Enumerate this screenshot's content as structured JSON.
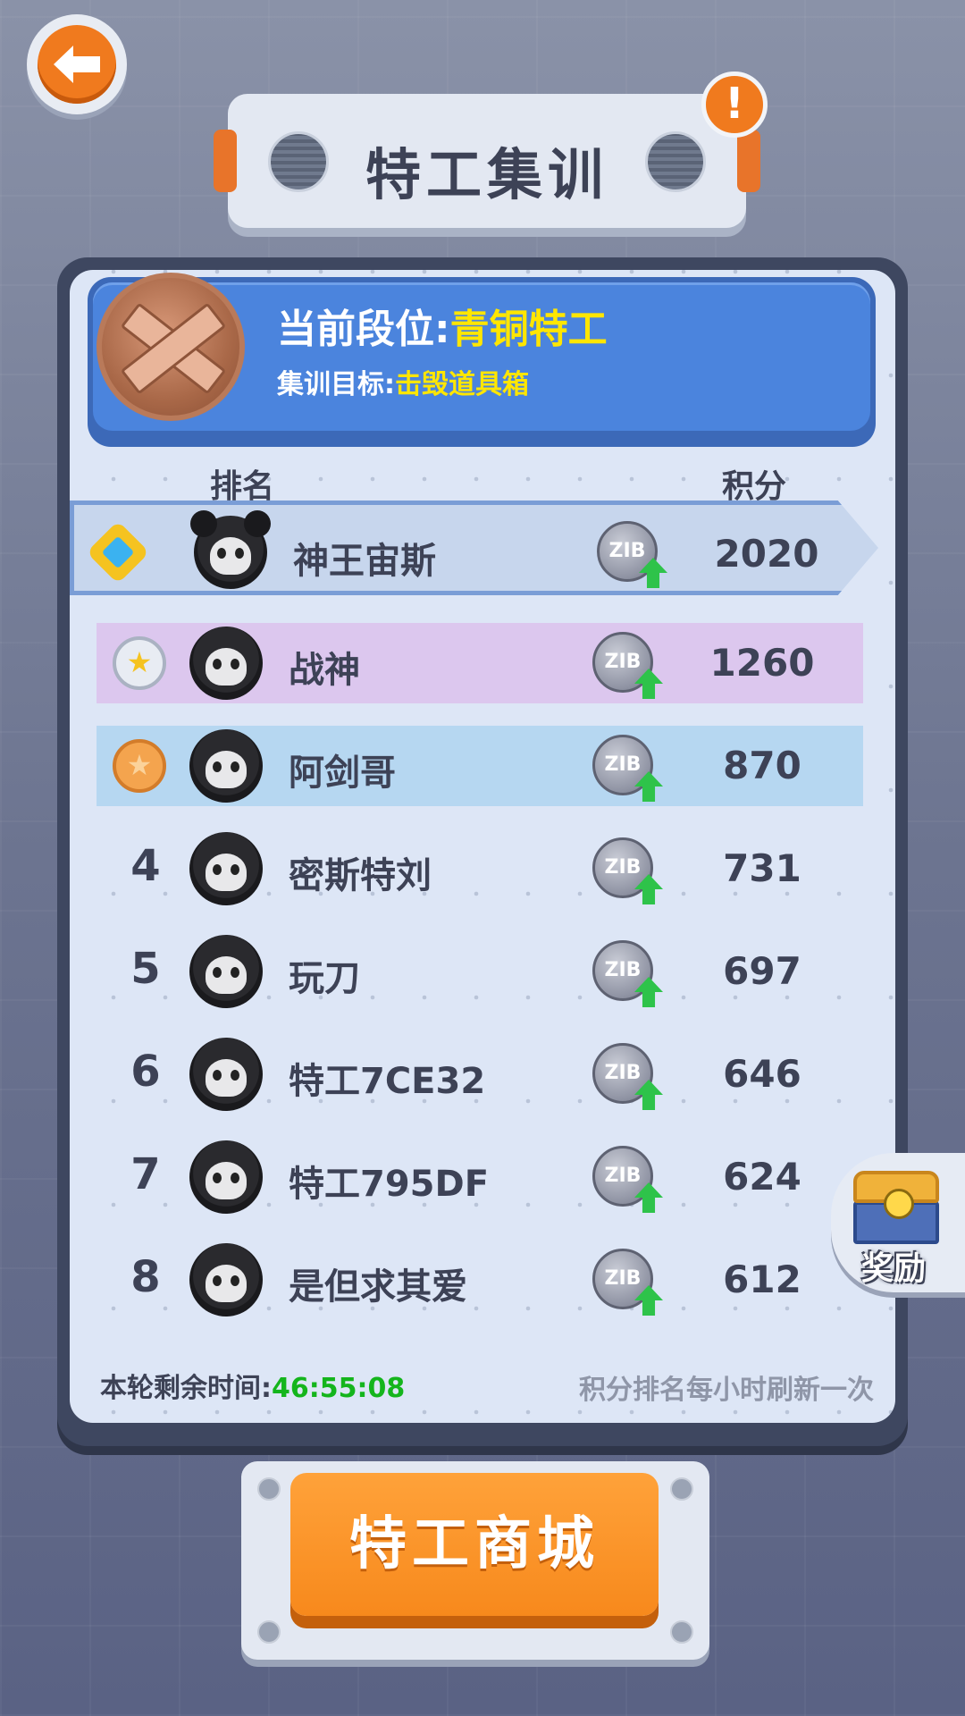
{
  "header": {
    "back_icon": "arrow-left-icon",
    "title": "特工集训",
    "info_icon": "!"
  },
  "rank_info": {
    "rank_prefix": "当前段位:",
    "rank_value": "青铜特工",
    "goal_prefix": "集训目标:",
    "goal_value": "击毁道具箱",
    "badge_icon": "bronze-rank-badge-icon"
  },
  "columns": {
    "rank": "排名",
    "score": "积分"
  },
  "rows": [
    {
      "rank": "1",
      "medal": "diamond",
      "name": "神王宙斯",
      "coin": "ZIB",
      "score": "2020",
      "highlight": "me"
    },
    {
      "rank": "2",
      "medal": "silver",
      "name": "战神",
      "coin": "ZIB",
      "score": "1260",
      "highlight": "purple"
    },
    {
      "rank": "3",
      "medal": "bronze",
      "name": "阿剑哥",
      "coin": "ZIB",
      "score": "870",
      "highlight": "blue"
    },
    {
      "rank": "4",
      "medal": "",
      "name": "密斯特刘",
      "coin": "ZIB",
      "score": "731",
      "highlight": ""
    },
    {
      "rank": "5",
      "medal": "",
      "name": "玩刀",
      "coin": "ZIB",
      "score": "697",
      "highlight": ""
    },
    {
      "rank": "6",
      "medal": "",
      "name": "特工7CE32",
      "coin": "ZIB",
      "score": "646",
      "highlight": ""
    },
    {
      "rank": "7",
      "medal": "",
      "name": "特工795DF",
      "coin": "ZIB",
      "score": "624",
      "highlight": ""
    },
    {
      "rank": "8",
      "medal": "",
      "name": "是但求其爱",
      "coin": "ZIB",
      "score": "612",
      "highlight": ""
    }
  ],
  "footer": {
    "timer_label": "本轮剩余时间:",
    "timer_value": "46:55:08",
    "refresh_note": "积分排名每小时刷新一次"
  },
  "reward": {
    "label": "奖励",
    "icon": "treasure-chest-icon"
  },
  "shop": {
    "label": "特工商城"
  },
  "colors": {
    "accent_orange": "#f7891c",
    "banner_blue": "#4b84dd",
    "highlight_yellow": "#ffe600",
    "timer_green": "#14b51c"
  }
}
